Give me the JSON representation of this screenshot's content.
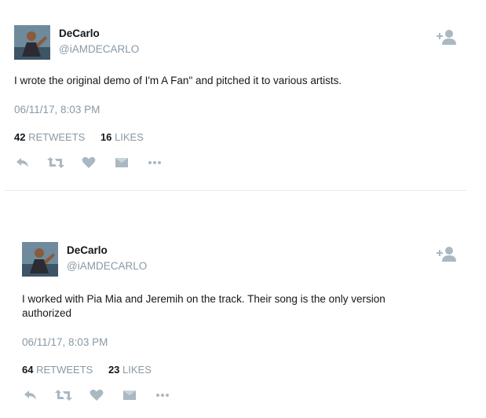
{
  "tweets": [
    {
      "author": "DeCarlo",
      "handle": "@iAMDECARLO",
      "text": "I wrote the original demo of I'm A Fan\" and pitched it to various artists.",
      "timestamp": "06/11/17, 8:03 PM",
      "retweets": "42",
      "retweets_label": "RETWEETS",
      "likes": "16",
      "likes_label": "LIKES"
    },
    {
      "author": "DeCarlo",
      "handle": "@iAMDECARLO",
      "text": "I worked with Pia Mia and Jeremih on the track. Their song is the only version authorized",
      "timestamp": "06/11/17, 8:03 PM",
      "retweets": "64",
      "retweets_label": "RETWEETS",
      "likes": "23",
      "likes_label": "LIKES"
    }
  ],
  "icons": [
    "follow-icon",
    "reply-icon",
    "retweet-icon",
    "like-icon",
    "dm-icon",
    "more-icon"
  ],
  "colors": {
    "muted": "#8899a6",
    "icon": "#aab8c2",
    "text": "#14171a"
  }
}
